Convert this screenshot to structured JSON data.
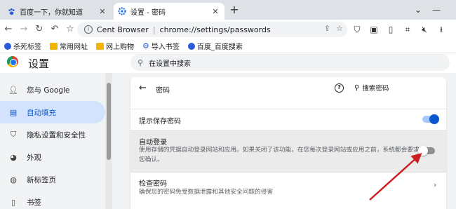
{
  "tabs": [
    {
      "title": "百度一下，你就知道",
      "icon": "baidu-paw-icon"
    },
    {
      "title": "设置 - 密码",
      "icon": "settings-gear-icon"
    }
  ],
  "toolbar": {
    "site_name": "Cent Browser",
    "url": "chrome://settings/passwords"
  },
  "bookmarks": [
    {
      "label": "杀死标签",
      "icon": "baidu-paw-icon"
    },
    {
      "label": "常用网址",
      "icon": "folder-icon"
    },
    {
      "label": "网上购物",
      "icon": "folder-icon"
    },
    {
      "label": "导入书签",
      "icon": "gear-icon"
    },
    {
      "label": "百度_百度搜索",
      "icon": "baidu-paw-icon"
    }
  ],
  "settings": {
    "title": "设置",
    "search_placeholder": "在设置中搜索"
  },
  "sidebar": {
    "items": [
      {
        "label": "您与 Google",
        "icon": "person-icon"
      },
      {
        "label": "自动填充",
        "icon": "clipboard-icon",
        "active": true
      },
      {
        "label": "隐私设置和安全性",
        "icon": "shield-icon"
      },
      {
        "label": "外观",
        "icon": "palette-icon"
      },
      {
        "label": "新标签页",
        "icon": "globe-icon"
      },
      {
        "label": "书签",
        "icon": "bookmark-icon"
      }
    ]
  },
  "passwords": {
    "page_label": "密码",
    "search_label": "搜索密码",
    "offer_to_save": {
      "label": "提示保存密码",
      "enabled": true
    },
    "auto_signin": {
      "label": "自动登录",
      "description": "使用存储的凭据自动登录网站和应用。如果关闭了该功能，在您每次登录网站或应用之前，系统都会要求您确认。",
      "enabled": false
    },
    "check_passwords": {
      "label": "检查密码",
      "description": "确保您的密码免受数据泄露和其他安全问题的侵害"
    }
  },
  "colors": {
    "accent": "#0b57d0",
    "annotation_arrow": "#cc1f1f"
  }
}
